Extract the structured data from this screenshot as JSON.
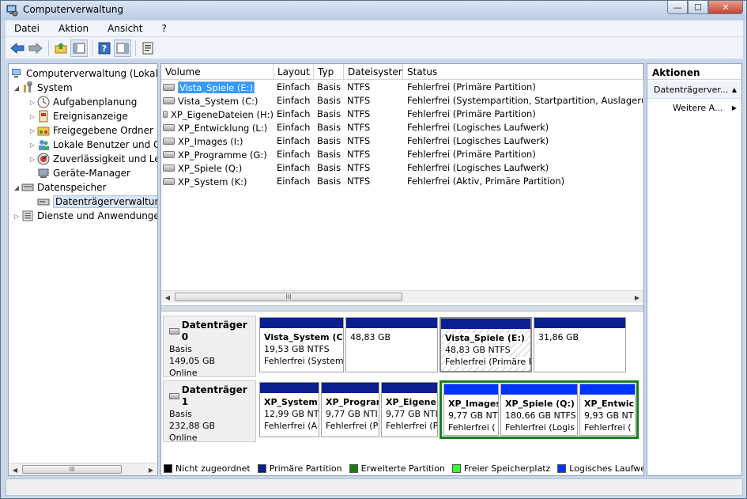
{
  "window": {
    "title": "Computerverwaltung",
    "min_glyph": "—",
    "max_glyph": "☐",
    "close_glyph": "✕"
  },
  "menu": [
    "Datei",
    "Aktion",
    "Ansicht",
    "?"
  ],
  "toolbar": [
    "back-icon",
    "forward-icon",
    "up-folder-icon",
    "show-hide-tree-icon",
    "help-icon",
    "show-hide-action-pane-icon",
    "properties-icon"
  ],
  "tree": {
    "root": "Computerverwaltung (Lokal)",
    "system": "System",
    "aufgabenplanung": "Aufgabenplanung",
    "ereignisanzeige": "Ereignisanzeige",
    "freigaben": "Freigegebene Ordner",
    "benutzer": "Lokale Benutzer und Gruppen",
    "zuverlaessigkeit": "Zuverlässigkeit und Leistung",
    "geraete": "Geräte-Manager",
    "datenspeicher": "Datenspeicher",
    "datentraeger": "Datenträgerverwaltung",
    "dienste": "Dienste und Anwendungen"
  },
  "volumes": {
    "headers": [
      "Volume",
      "Layout",
      "Typ",
      "Dateisystem",
      "Status"
    ],
    "rows": [
      [
        "Vista_Spiele (E:)",
        "Einfach",
        "Basis",
        "NTFS",
        "Fehlerfrei (Primäre Partition)"
      ],
      [
        "Vista_System (C:)",
        "Einfach",
        "Basis",
        "NTFS",
        "Fehlerfrei (Systempartition, Startpartition, Auslagerungsdatei"
      ],
      [
        "XP_EigeneDateien (H:)",
        "Einfach",
        "Basis",
        "NTFS",
        "Fehlerfrei (Primäre Partition)"
      ],
      [
        "XP_Entwicklung (L:)",
        "Einfach",
        "Basis",
        "NTFS",
        "Fehlerfrei (Logisches Laufwerk)"
      ],
      [
        "XP_Images (I:)",
        "Einfach",
        "Basis",
        "NTFS",
        "Fehlerfrei (Logisches Laufwerk)"
      ],
      [
        "XP_Programme (G:)",
        "Einfach",
        "Basis",
        "NTFS",
        "Fehlerfrei (Primäre Partition)"
      ],
      [
        "XP_Spiele (Q:)",
        "Einfach",
        "Basis",
        "NTFS",
        "Fehlerfrei (Logisches Laufwerk)"
      ],
      [
        "XP_System (K:)",
        "Einfach",
        "Basis",
        "NTFS",
        "Fehlerfrei (Aktiv, Primäre Partition)"
      ]
    ]
  },
  "disks": [
    {
      "name": "Datenträger 0",
      "type": "Basis",
      "size": "149,05 GB",
      "state": "Online",
      "partitions": [
        {
          "name": "Vista_System  (C:",
          "size": "19,53 GB NTFS",
          "status": "Fehlerfrei (System"
        },
        {
          "name": "",
          "size": "48,83 GB",
          "status": ""
        },
        {
          "name": "Vista_Spiele  (E:)",
          "size": "48,83 GB NTFS",
          "status": "Fehlerfrei (Primäre P"
        },
        {
          "name": "",
          "size": "31,86 GB",
          "status": ""
        }
      ]
    },
    {
      "name": "Datenträger 1",
      "type": "Basis",
      "size": "232,88 GB",
      "state": "Online",
      "partitions": [
        {
          "name": "XP_System",
          "size": "12,99 GB NT",
          "status": "Fehlerfrei (A"
        },
        {
          "name": "XP_Progran",
          "size": "9,77 GB NTI",
          "status": "Fehlerfrei (P"
        },
        {
          "name": "XP_EigeneI",
          "size": "9,77 GB NTI",
          "status": "Fehlerfrei (P"
        },
        {
          "name": "XP_Images",
          "size": "9,77 GB NT",
          "status": "Fehlerfrei ("
        },
        {
          "name": "XP_Spiele  (Q:)",
          "size": "180,66 GB NTFS",
          "status": "Fehlerfrei (Logis"
        },
        {
          "name": "XP_Entwic",
          "size": "9,93 GB NT",
          "status": "Fehlerfrei ("
        }
      ]
    }
  ],
  "legend": [
    {
      "label": "Nicht zugeordnet",
      "color": "#000000"
    },
    {
      "label": "Primäre Partition",
      "color": "#0b1f8f"
    },
    {
      "label": "Erweiterte Partition",
      "color": "#1a7d1a"
    },
    {
      "label": "Freier Speicherplatz",
      "color": "#33ff33"
    },
    {
      "label": "Logisches Laufwerk",
      "color": "#0033ff"
    }
  ],
  "actions": {
    "header": "Aktionen",
    "section": "Datenträgerver...",
    "more": "Weitere A..."
  },
  "scroll_thumb": "III"
}
